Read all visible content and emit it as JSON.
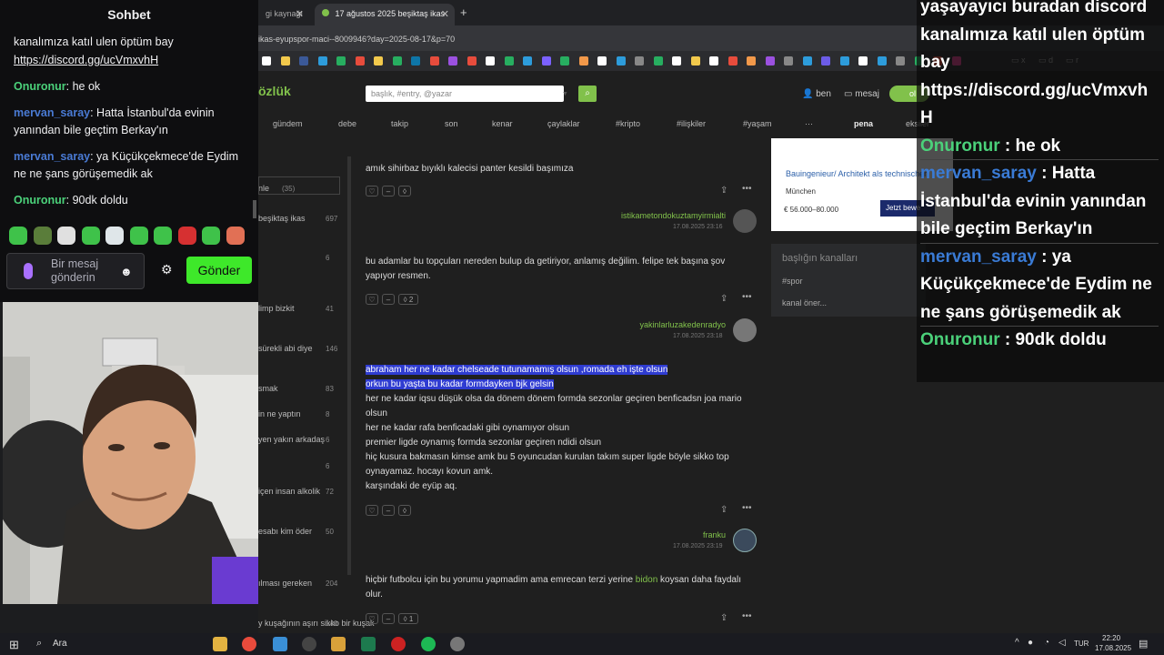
{
  "browser": {
    "tabs": [
      {
        "label": "gi kaynağı",
        "active": false
      },
      {
        "label": "17 ağustos 2025 beşiktaş ikas",
        "active": true
      }
    ],
    "new_tab": "+",
    "url": "ikas-eyupspor-maci--8009946?day=2025-08-17&p=70",
    "bookmark_folders": [
      "x",
      "d",
      "r"
    ]
  },
  "site": {
    "logo": "özlük",
    "search_placeholder": "başlık, #entry, @yazar",
    "header_links": {
      "ben": "ben",
      "mesaj": "mesaj",
      "pill": "ol"
    },
    "nav": [
      "gündem",
      "debe",
      "takip",
      "son",
      "kenar",
      "çaylaklar",
      "#kripto",
      "#ilişkiler",
      "#yaşam",
      "···",
      "pena",
      "eksiler"
    ],
    "topics": [
      {
        "label": "nle",
        "count": "(35)"
      },
      {
        "label": "beşiktaş ikas",
        "count": "697"
      },
      {
        "label": "",
        "count": "6"
      },
      {
        "label": "limp bizkit",
        "count": "41"
      },
      {
        "label": "sürekli abi diye",
        "count": "146"
      },
      {
        "label": "smak",
        "count": "83"
      },
      {
        "label": "in ne yaptın",
        "count": "8"
      },
      {
        "label": "yen yakın arkadaş",
        "count": "6"
      },
      {
        "label": "",
        "count": "6"
      },
      {
        "label": "içen insan alkolik",
        "count": "72"
      },
      {
        "label": "esabı kim öder",
        "count": "50"
      },
      {
        "label": "ılması gereken",
        "count": "204"
      },
      {
        "label": "y kuşağının aşırı sikko bir kuşak",
        "count": "140"
      }
    ],
    "entries": [
      {
        "text": "amık sihirbaz bıyıklı kalecisi panter kesildi başımıza",
        "author": "istikametondokuztamyirmialti",
        "date": "17.08.2025 23:16",
        "likes": ""
      },
      {
        "text": "bu adamlar bu topçuları nereden bulup da getiriyor, anlamış değilim. felipe tek başına şov yapıyor resmen.",
        "author": "yakinlarluzakedenradyo",
        "date": "17.08.2025 23:18",
        "likes": "2"
      },
      {
        "lines_selected": [
          "abraham her ne kadar chelseade tutunamamış olsun ,romada eh işte olsun",
          "orkun bu yaşta bu kadar formdayken bjk gelsin"
        ],
        "lines": [
          "her ne kadar iqsu düşük olsa da dönem dönem formda sezonlar geçiren benficadsn joa mario olsun",
          "her ne kadar rafa benficadaki gibi oynamıyor olsun",
          "premier ligde oynamış formda sezonlar geçiren ndidi olsun",
          "hiç kusura bakmasın kimse amk bu 5 oyuncudan kurulan takım super ligde böyle sikko top oynayamaz. hocayı kovun amk.",
          "karşındaki de eyüp aq."
        ],
        "author": "franku",
        "date": "17.08.2025 23:19",
        "likes": ""
      },
      {
        "text_before": "hiçbir futbolcu için bu yorumu yapmadim ama emrecan terzi yerine ",
        "link": "bidon",
        "text_after": " koysan daha faydalı olur.",
        "likes": "1"
      }
    ],
    "ad": {
      "title": "Bauingenieur/ Architekt als technischer",
      "city": "München",
      "salary": "€ 56.000–80.000",
      "cta": "Jetzt bewe"
    },
    "channels": {
      "title": "başlığın kanalları",
      "tag": "#spor",
      "suggest": "kanal öner..."
    }
  },
  "overlay": {
    "lines": [
      {
        "kind": "text",
        "text": "yaşayayıcı buradan discord"
      },
      {
        "kind": "text",
        "text": "kanalımıza katıl ulen öptüm"
      },
      {
        "kind": "text",
        "text": "bay"
      },
      {
        "kind": "text",
        "text": "https://discord.gg/ucVmxvh"
      },
      {
        "kind": "text",
        "text": "H"
      },
      {
        "kind": "msg",
        "name": "Onuronur",
        "color": "#4bd17a",
        "text": ": he ok"
      },
      {
        "kind": "msg",
        "name": "mervan_saray",
        "color": "#3a7bd5",
        "text": ": Hatta"
      },
      {
        "kind": "text",
        "text": "İstanbul'da evinin yanından"
      },
      {
        "kind": "text",
        "text": "bile geçtim Berkay'ın"
      },
      {
        "kind": "msg",
        "name": "mervan_saray",
        "color": "#3a7bd5",
        "text": ": ya"
      },
      {
        "kind": "text",
        "text": "Küçükçekmece'de Eydim ne"
      },
      {
        "kind": "text",
        "text": "ne şans görüşemedik ak"
      },
      {
        "kind": "msg",
        "name": "Onuronur",
        "color": "#4bd17a",
        "text": ": 90dk doldu"
      }
    ]
  },
  "chat": {
    "title": "Sohbet",
    "line1": "kanalımıza katıl ulen öptüm bay",
    "link": "https://discord.gg/ucVmxvhH",
    "messages": [
      {
        "name": "Onuronur",
        "text": ": he ok",
        "color": "#4bd17a"
      },
      {
        "name": "mervan_saray",
        "text": ": Hatta İstanbul'da evinin yanından bile geçtim Berkay'ın",
        "color": "#4a7bd5"
      },
      {
        "name": "mervan_saray",
        "text": ": ya Küçükçekmece'de Eydim ne ne şans görüşemedik ak",
        "color": "#4a7bd5"
      },
      {
        "name": "Onuronur",
        "text": ": 90dk doldu",
        "color": "#4bd17a"
      }
    ],
    "input_placeholder": "Bir mesaj gönderin",
    "send_label": "Gönder"
  },
  "taskbar": {
    "search": "Ara",
    "lang": "TUR",
    "time": "22:20",
    "date": "17.08.2025"
  }
}
